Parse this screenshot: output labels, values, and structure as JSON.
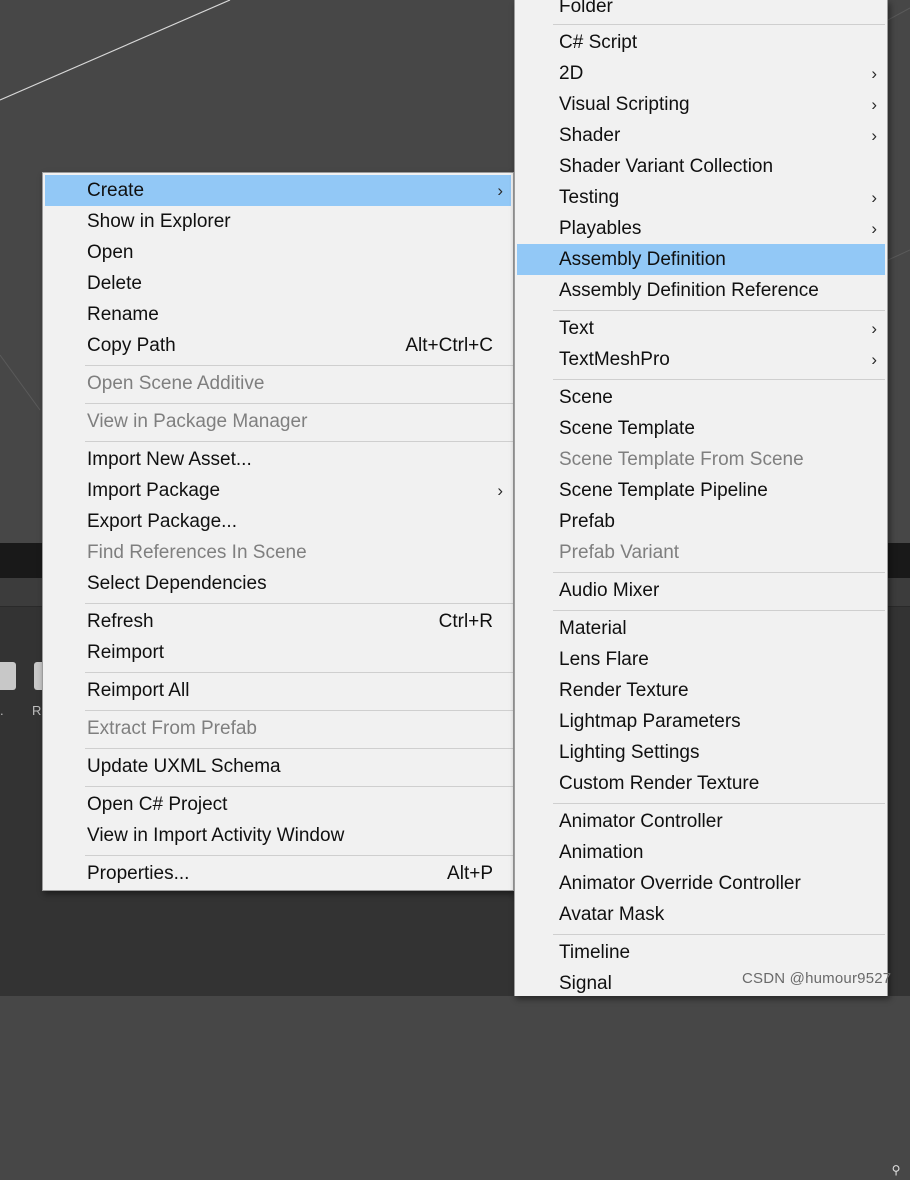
{
  "context_menu": {
    "items": [
      {
        "label": "Create",
        "shortcut": "",
        "arrow": "›"
      },
      {
        "label": "Show in Explorer"
      },
      {
        "label": "Open"
      },
      {
        "label": "Delete"
      },
      {
        "label": "Rename"
      },
      {
        "label": "Copy Path",
        "shortcut": "Alt+Ctrl+C"
      },
      {
        "label": "Open Scene Additive"
      },
      {
        "label": "View in Package Manager"
      },
      {
        "label": "Import New Asset..."
      },
      {
        "label": "Import Package",
        "arrow": "›"
      },
      {
        "label": "Export Package..."
      },
      {
        "label": "Find References In Scene"
      },
      {
        "label": "Select Dependencies"
      },
      {
        "label": "Refresh",
        "shortcut": "Ctrl+R"
      },
      {
        "label": "Reimport"
      },
      {
        "label": "Reimport All"
      },
      {
        "label": "Extract From Prefab"
      },
      {
        "label": "Update UXML Schema"
      },
      {
        "label": "Open C# Project"
      },
      {
        "label": "View in Import Activity Window"
      },
      {
        "label": "Properties...",
        "shortcut": "Alt+P"
      }
    ]
  },
  "create_submenu": {
    "items": [
      {
        "label": "Folder"
      },
      {
        "label": "C# Script"
      },
      {
        "label": "2D",
        "arrow": "›"
      },
      {
        "label": "Visual Scripting",
        "arrow": "›"
      },
      {
        "label": "Shader",
        "arrow": "›"
      },
      {
        "label": "Shader Variant Collection"
      },
      {
        "label": "Testing",
        "arrow": "›"
      },
      {
        "label": "Playables",
        "arrow": "›"
      },
      {
        "label": "Assembly Definition"
      },
      {
        "label": "Assembly Definition Reference"
      },
      {
        "label": "Text",
        "arrow": "›"
      },
      {
        "label": "TextMeshPro",
        "arrow": "›"
      },
      {
        "label": "Scene"
      },
      {
        "label": "Scene Template"
      },
      {
        "label": "Scene Template From Scene"
      },
      {
        "label": "Scene Template Pipeline"
      },
      {
        "label": "Prefab"
      },
      {
        "label": "Prefab Variant"
      },
      {
        "label": "Audio Mixer"
      },
      {
        "label": "Material"
      },
      {
        "label": "Lens Flare"
      },
      {
        "label": "Render Texture"
      },
      {
        "label": "Lightmap Parameters"
      },
      {
        "label": "Lighting Settings"
      },
      {
        "label": "Custom Render Texture"
      },
      {
        "label": "Animator Controller"
      },
      {
        "label": "Animation"
      },
      {
        "label": "Animator Override Controller"
      },
      {
        "label": "Avatar Mask"
      },
      {
        "label": "Timeline"
      },
      {
        "label": "Signal"
      }
    ]
  },
  "background": {
    "asset_labels": [
      ".",
      "R"
    ],
    "search_icon": "search-icon"
  },
  "watermark": "CSDN @humour9527",
  "colors": {
    "menu_bg": "#f1f1f1",
    "highlight": "#92c8f6",
    "disabled_text": "#7f7f7f",
    "scene_bg": "#474747"
  }
}
